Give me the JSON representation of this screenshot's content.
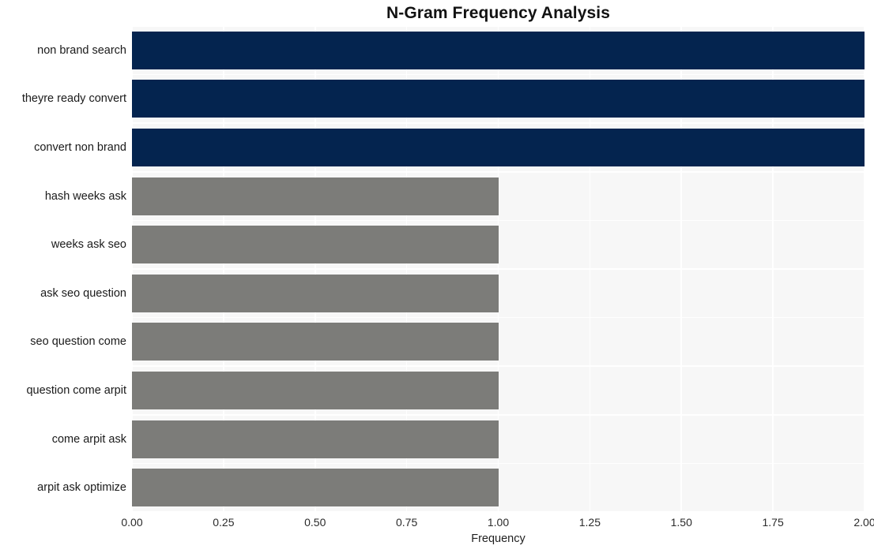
{
  "chart_data": {
    "type": "bar",
    "orientation": "horizontal",
    "title": "N-Gram Frequency Analysis",
    "xlabel": "Frequency",
    "ylabel": "",
    "xlim": [
      0.0,
      2.0
    ],
    "xticks": [
      "0.00",
      "0.25",
      "0.50",
      "0.75",
      "1.00",
      "1.25",
      "1.50",
      "1.75",
      "2.00"
    ],
    "xtick_values": [
      0.0,
      0.25,
      0.5,
      0.75,
      1.0,
      1.25,
      1.5,
      1.75,
      2.0
    ],
    "grid": true,
    "legend": "none",
    "categories": [
      "non brand search",
      "theyre ready convert",
      "convert non brand",
      "hash weeks ask",
      "weeks ask seo",
      "ask seo question",
      "seo question come",
      "question come arpit",
      "come arpit ask",
      "arpit ask optimize"
    ],
    "values": [
      2,
      2,
      2,
      1,
      1,
      1,
      1,
      1,
      1,
      1
    ],
    "bar_colors": [
      "#04244f",
      "#04244f",
      "#04244f",
      "#7c7c79",
      "#7c7c79",
      "#7c7c79",
      "#7c7c79",
      "#7c7c79",
      "#7c7c79",
      "#7c7c79"
    ],
    "colors": {
      "highlight": "#04244f",
      "normal": "#7c7c79",
      "plot_background": "#f7f7f7",
      "figure_background": "#ffffff",
      "gridline": "#ffffff",
      "title_text": "#121212",
      "axis_text": "#1f1f1f"
    }
  }
}
